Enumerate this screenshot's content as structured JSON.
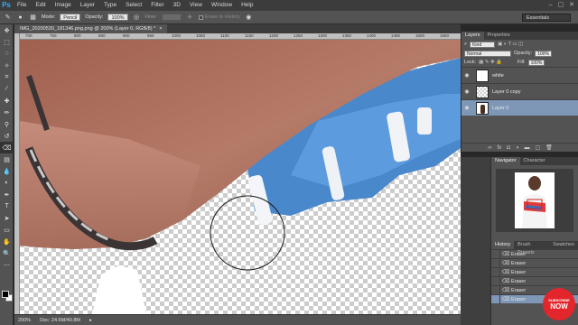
{
  "menu": {
    "logo": "Ps",
    "items": [
      "File",
      "Edit",
      "Image",
      "Layer",
      "Type",
      "Select",
      "Filter",
      "3D",
      "View",
      "Window",
      "Help"
    ],
    "window_controls": [
      "–",
      "▢",
      "✕"
    ]
  },
  "options": {
    "mode_label": "Mode:",
    "mode_value": "Pencil",
    "opacity_label": "Opacity:",
    "opacity_value": "100%",
    "flow_label": "Flow:",
    "erase_history_label": "Erase to History",
    "workspace": "Essentials"
  },
  "document": {
    "tab_title": "IMG_20200530_181346.png.png @ 200% (Layer 0, RGB/8) *",
    "tab_close": "×",
    "ruler_ticks": [
      "700",
      "750",
      "800",
      "850",
      "900",
      "950",
      "1000",
      "1050",
      "1100",
      "1150",
      "1200",
      "1250",
      "1300",
      "1350",
      "1400",
      "1450",
      "1500",
      "1550"
    ]
  },
  "status": {
    "zoom": "200%",
    "doc_size": "Doc: 24.6M/40.8M"
  },
  "layers_panel": {
    "tabs": [
      "Layers",
      "Properties"
    ],
    "kind_label": "Kind",
    "blend_mode": "Normal",
    "opacity_label": "Opacity:",
    "opacity_value": "100%",
    "lock_label": "Lock:",
    "fill_label": "Fill:",
    "fill_value": "100%",
    "layers": [
      {
        "name": "white",
        "selected": false
      },
      {
        "name": "Layer 0 copy",
        "selected": false
      },
      {
        "name": "Layer 0",
        "selected": true
      }
    ],
    "footer_icons": [
      "link-icon",
      "fx-icon",
      "mask-icon",
      "adjustment-icon",
      "folder-icon",
      "new-layer-icon",
      "trash-icon"
    ]
  },
  "navigator_panel": {
    "tabs": [
      "Navigator",
      "Character"
    ]
  },
  "history_panel": {
    "tabs": [
      "History",
      "Brush Presets",
      "Swatches"
    ],
    "items": [
      "Eraser",
      "Eraser",
      "Eraser",
      "Eraser",
      "Eraser",
      "Eraser"
    ]
  },
  "overlay": {
    "subscribe_top": "SUBSCRIBE",
    "subscribe_main": "NOW"
  },
  "colors": {
    "selection_blue": "#7f97b7",
    "panel_bg": "#535353",
    "subscribe_red": "#e3262b"
  }
}
